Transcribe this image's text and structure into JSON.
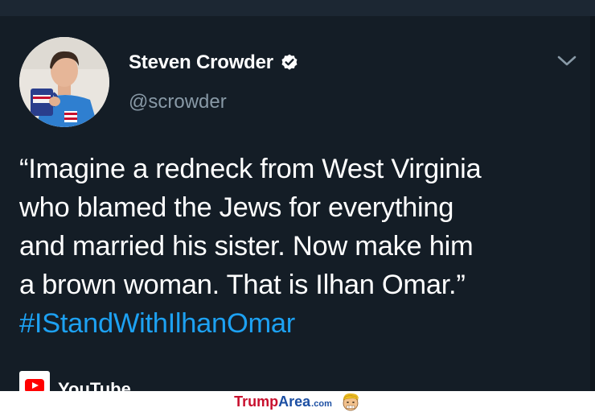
{
  "tweet": {
    "author_name": "Steven Crowder",
    "author_handle": "@scrowder",
    "verified": true,
    "text_lines": [
      "“Imagine a redneck from West Virginia",
      "who blamed the Jews for everything",
      "and married his sister. Now make him",
      "a brown woman. That is Ilhan Omar.”"
    ],
    "hashtag": "#IStandWithIlhanOmar",
    "source_label": "YouTube",
    "menu_icon": "chevron-down-icon"
  },
  "watermark": {
    "part1": "Trump",
    "part2": "Area",
    "part3": ".com"
  },
  "colors": {
    "background": "#141d26",
    "text": "#ffffff",
    "muted": "#8899a6",
    "link": "#1da1f2"
  }
}
